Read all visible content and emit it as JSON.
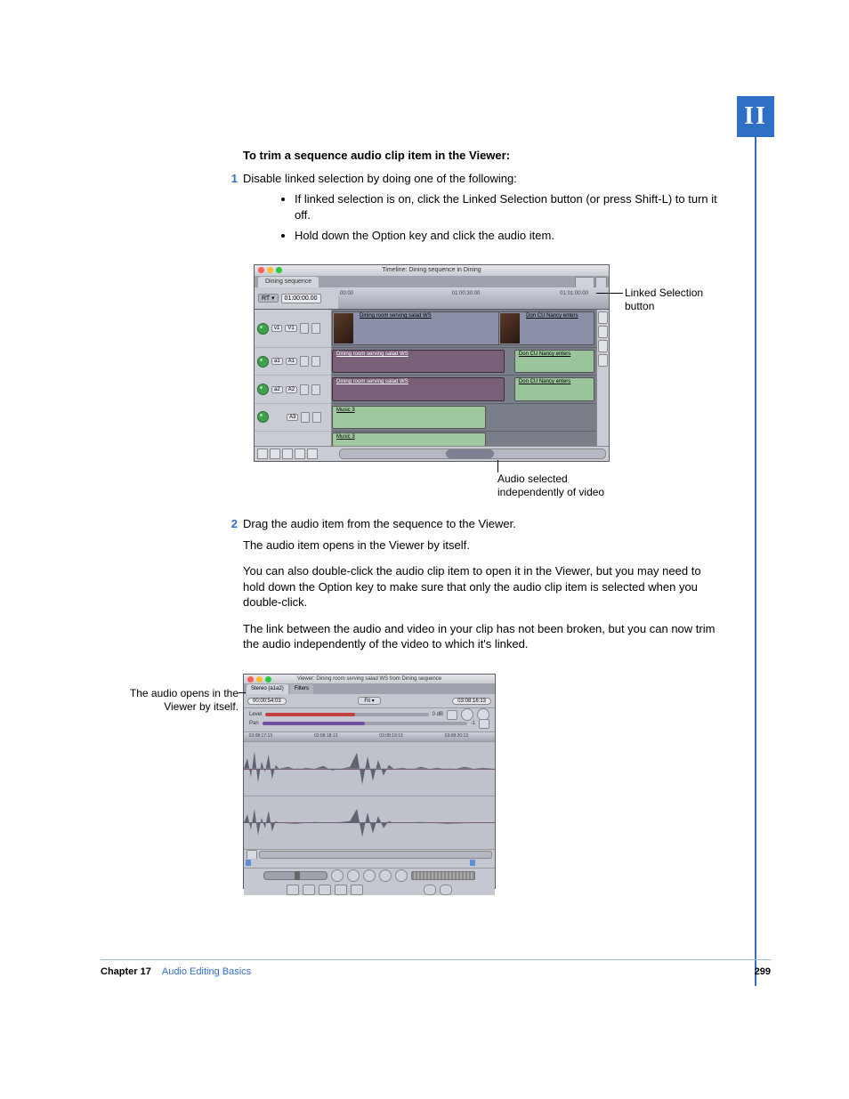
{
  "badge": "II",
  "heading": "To trim a sequence audio clip item in the Viewer:",
  "step1_num": "1",
  "step1_text": "Disable linked selection by doing one of the following:",
  "bullet1": "If linked selection is on, click the Linked Selection button (or press Shift-L) to turn it off.",
  "bullet2": "Hold down the Option key and click the audio item.",
  "fig1": {
    "window_title": "Timeline: Dining sequence in Dining",
    "tab": "Dining sequence",
    "rt": "RT ▾",
    "tc": "01:00:00.00",
    "ruler": {
      "t0": "00:00",
      "t1": "01:00:30:00",
      "t2": "01:01:00:00"
    },
    "tracks": {
      "v1_src": "v1",
      "v1_dst": "V1",
      "a1_src": "a1",
      "a1_dst": "A1",
      "a2_src": "a2",
      "a2_dst": "A2",
      "a3_dst": "A3"
    },
    "clips": {
      "vid1": "Dining room serving salad WS",
      "vid2": "Don CU Nancy enters",
      "aud1": "Dining room serving salad WS",
      "aud2": "Don CU Nancy enters",
      "aud3": "Dining room serving salad WS",
      "aud4": "Don CU Nancy enters",
      "mus1": "Music 3",
      "mus2": "Music 3"
    },
    "callout_right_1": "Linked Selection",
    "callout_right_2": "button",
    "callout_bottom_1": "Audio selected",
    "callout_bottom_2": "independently of video"
  },
  "step2_num": "2",
  "step2_text": "Drag the audio item from the sequence to the Viewer.",
  "para1": "The audio item opens in the Viewer by itself.",
  "para2": "You can also double-click the audio clip item to open it in the Viewer, but you may need to hold down the Option key to make sure that only the audio clip item is selected when you double-click.",
  "para3": "The link between the audio and video in your clip has not been broken, but you can now trim the audio independently of the video to which it's linked.",
  "fig2": {
    "title": "Viewer: Dining room serving salad WS from Dining sequence",
    "tab1": "Stereo (a1a2)",
    "tab2": "Filters",
    "dur": "00:00:54:03",
    "fit": "Fit ▾",
    "cur": "03:08:16:13",
    "level_lbl": "Level",
    "level_val": "0 dB",
    "pan_lbl": "Pan",
    "pan_val": "-1",
    "ruler": {
      "t0": "03:08:17:13",
      "t1": "03:08:18:13",
      "t2": "03:08:19:13",
      "t3": "03:08:20:13"
    },
    "left_callout_1": "The audio opens in the",
    "left_callout_2": "Viewer by itself."
  },
  "footer": {
    "chapter": "Chapter 17",
    "title": "Audio Editing Basics",
    "page": "299"
  }
}
